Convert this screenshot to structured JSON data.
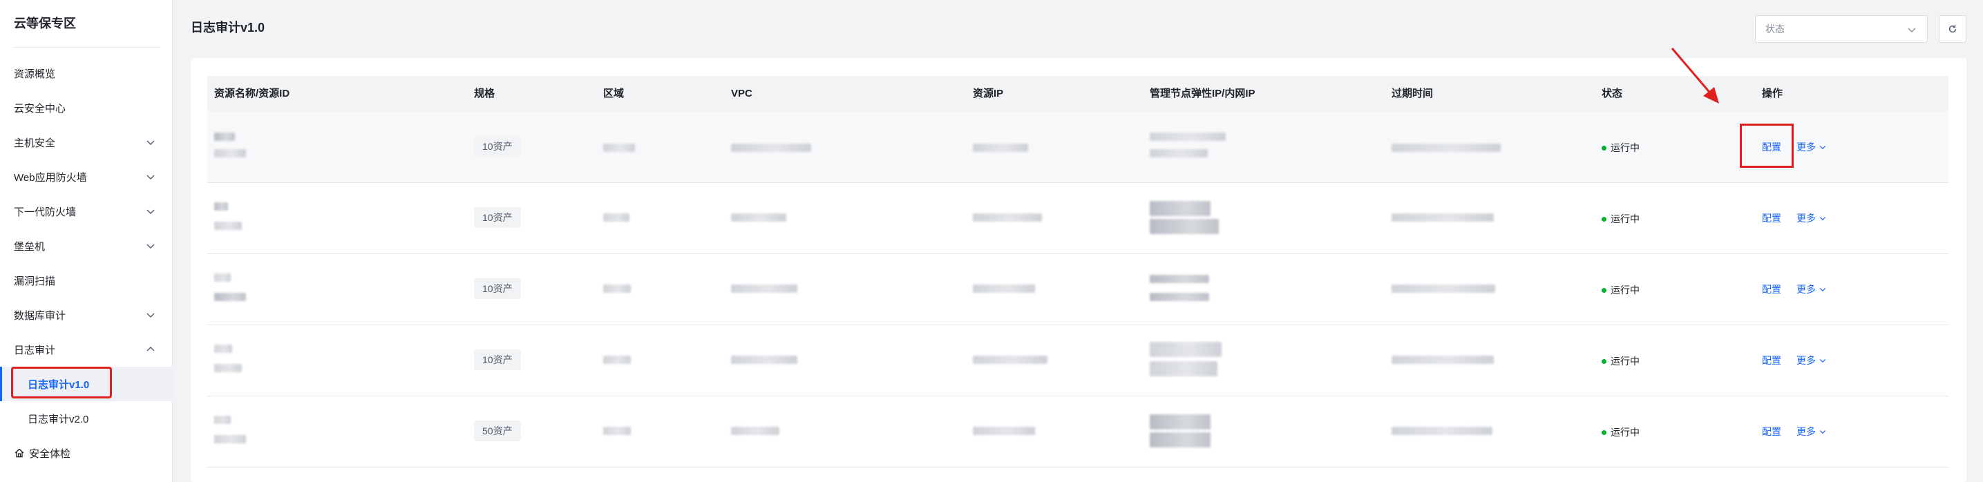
{
  "app": {
    "title": "云等保专区",
    "page_title": "日志审计v1.0"
  },
  "sidebar": {
    "items": [
      {
        "label": "资源概览"
      },
      {
        "label": "云安全中心"
      },
      {
        "label": "主机安全"
      },
      {
        "label": "Web应用防火墙"
      },
      {
        "label": "下一代防火墙"
      },
      {
        "label": "堡垒机"
      },
      {
        "label": "漏洞扫描"
      },
      {
        "label": "数据库审计"
      },
      {
        "label": "日志审计"
      },
      {
        "label": "日志审计v1.0"
      },
      {
        "label": "日志审计v2.0"
      },
      {
        "label": "安全体检"
      }
    ]
  },
  "filters": {
    "status_placeholder": "状态"
  },
  "table": {
    "headers": [
      "资源名称/资源ID",
      "规格",
      "区域",
      "VPC",
      "资源IP",
      "管理节点弹性IP/内网IP",
      "过期时间",
      "状态",
      "操作"
    ],
    "rows": [
      {
        "spec": "10资产",
        "status": "运行中",
        "config": "配置",
        "more": "更多"
      },
      {
        "spec": "10资产",
        "status": "运行中",
        "config": "配置",
        "more": "更多"
      },
      {
        "spec": "10资产",
        "status": "运行中",
        "config": "配置",
        "more": "更多"
      },
      {
        "spec": "10资产",
        "status": "运行中",
        "config": "配置",
        "more": "更多"
      },
      {
        "spec": "50资产",
        "status": "运行中",
        "config": "配置",
        "more": "更多"
      }
    ]
  },
  "colors": {
    "accent": "#1664ff",
    "running": "#00b42a",
    "highlight": "#e02020"
  }
}
